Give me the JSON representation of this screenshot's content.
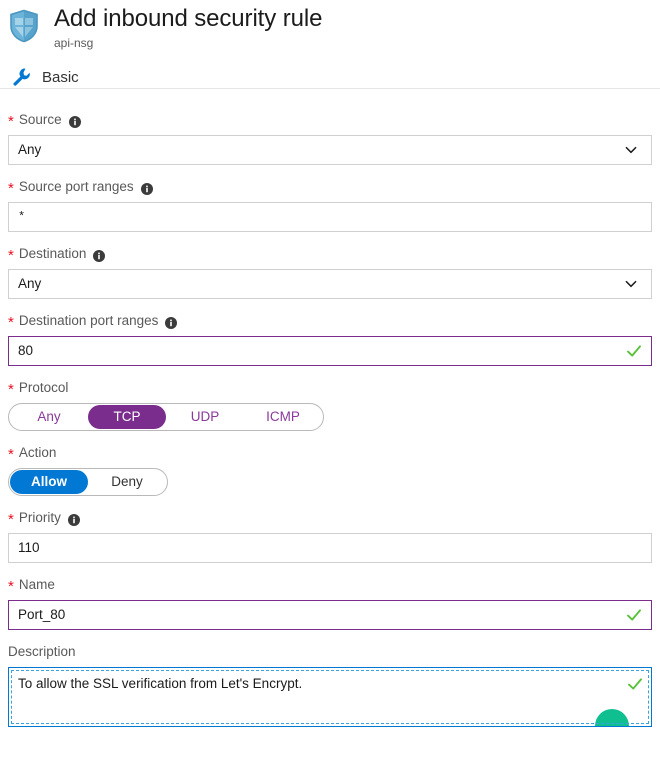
{
  "header": {
    "icon": "shield-icon",
    "title": "Add inbound security rule",
    "subtitle": "api-nsg",
    "section_icon": "wrench-icon",
    "section_label": "Basic"
  },
  "colors": {
    "accent_blue": "#0078d4",
    "accent_purple": "#7a2d8c",
    "required_red": "#e81123",
    "valid_green": "#5ac13c",
    "teal": "#0fbf8f",
    "border_grey": "#d0d0d0"
  },
  "form": {
    "source": {
      "label": "Source",
      "required": true,
      "info": true,
      "type": "dropdown",
      "value": "Any",
      "icon": "chevron-down-icon"
    },
    "source_port_ranges": {
      "label": "Source port ranges",
      "required": true,
      "info": true,
      "type": "text",
      "value": "*"
    },
    "destination": {
      "label": "Destination",
      "required": true,
      "info": true,
      "type": "dropdown",
      "value": "Any",
      "icon": "chevron-down-icon"
    },
    "destination_port_ranges": {
      "label": "Destination port ranges",
      "required": true,
      "info": true,
      "type": "text",
      "value": "80",
      "valid": true,
      "icon": "check-icon"
    },
    "protocol": {
      "label": "Protocol",
      "required": true,
      "info": false,
      "type": "pill-group",
      "selected": "TCP",
      "options": [
        "Any",
        "TCP",
        "UDP",
        "ICMP"
      ]
    },
    "action": {
      "label": "Action",
      "required": true,
      "info": false,
      "type": "pill-group",
      "selected": "Allow",
      "options": [
        "Allow",
        "Deny"
      ]
    },
    "priority": {
      "label": "Priority",
      "required": true,
      "info": true,
      "type": "text",
      "value": "110"
    },
    "name": {
      "label": "Name",
      "required": true,
      "info": false,
      "type": "text",
      "value": "Port_80",
      "valid": true,
      "icon": "check-icon"
    },
    "description": {
      "label": "Description",
      "required": false,
      "info": false,
      "type": "textarea",
      "value": "To allow the SSL verification from Let's Encrypt.",
      "focused": true,
      "valid": true,
      "icon": "check-icon"
    }
  }
}
